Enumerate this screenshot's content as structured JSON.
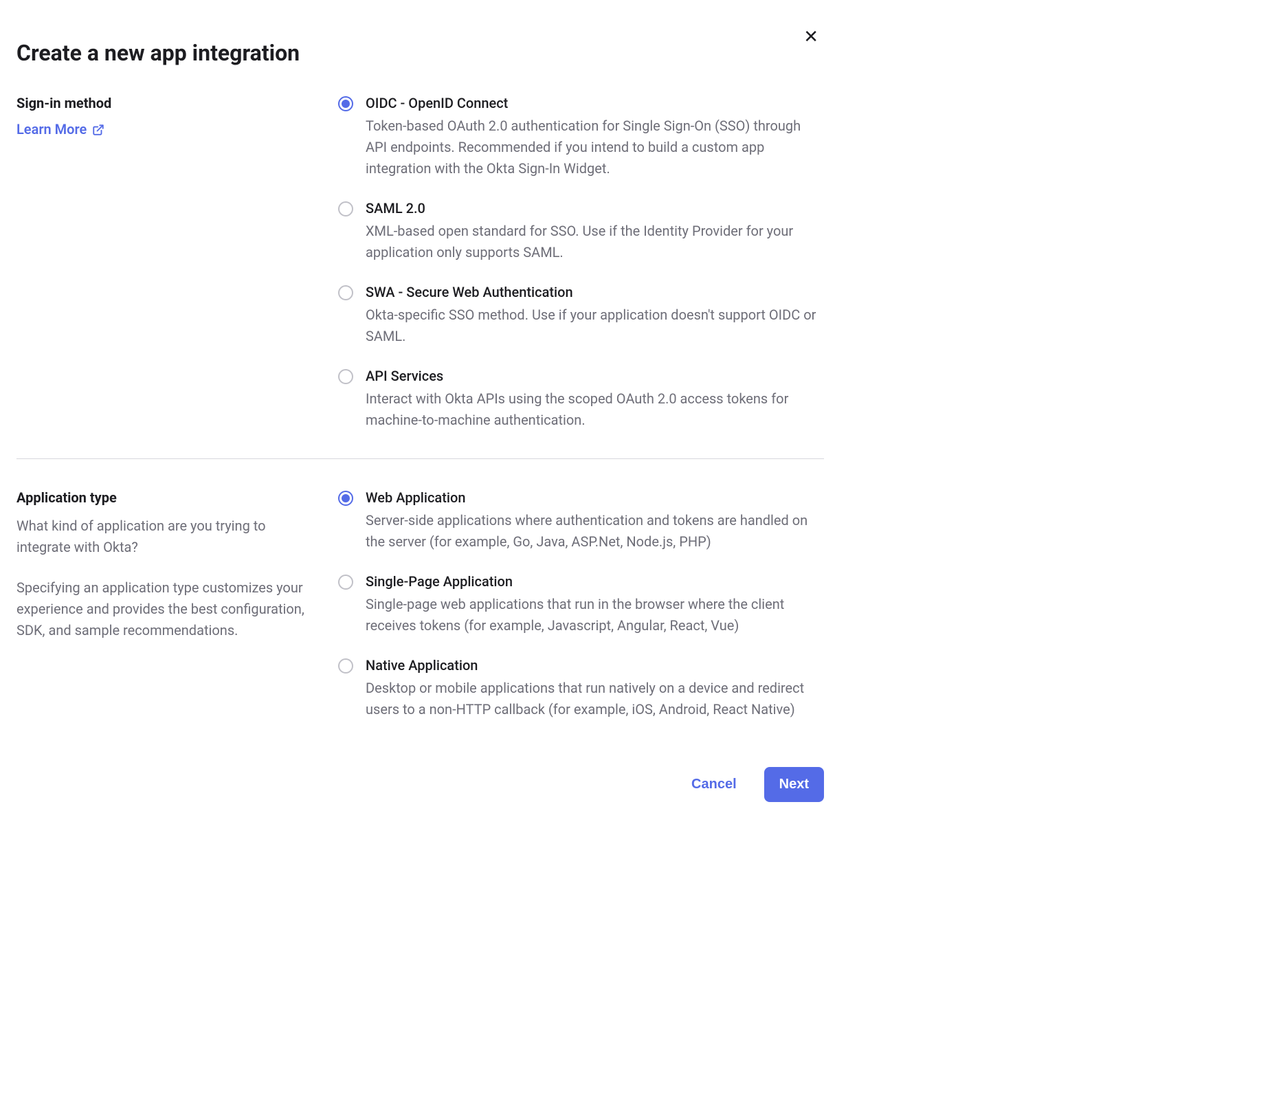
{
  "title": "Create a new app integration",
  "close_label": "✕",
  "learn_more": "Learn More",
  "sections": {
    "sign_in": {
      "heading": "Sign-in method",
      "options": [
        {
          "title": "OIDC - OpenID Connect",
          "desc": "Token-based OAuth 2.0 authentication for Single Sign-On (SSO) through API endpoints. Recommended if you intend to build a custom app integration with the Okta Sign-In Widget.",
          "selected": true
        },
        {
          "title": "SAML 2.0",
          "desc": "XML-based open standard for SSO. Use if the Identity Provider for your application only supports SAML.",
          "selected": false
        },
        {
          "title": "SWA - Secure Web Authentication",
          "desc": "Okta-specific SSO method. Use if your application doesn't support OIDC or SAML.",
          "selected": false
        },
        {
          "title": "API Services",
          "desc": "Interact with Okta APIs using the scoped OAuth 2.0 access tokens for machine-to-machine authentication.",
          "selected": false
        }
      ]
    },
    "app_type": {
      "heading": "Application type",
      "para1": "What kind of application are you trying to integrate with Okta?",
      "para2": "Specifying an application type customizes your experience and provides the best configuration, SDK, and sample recommendations.",
      "options": [
        {
          "title": "Web Application",
          "desc": "Server-side applications where authentication and tokens are handled on the server (for example, Go, Java, ASP.Net, Node.js, PHP)",
          "selected": true
        },
        {
          "title": "Single-Page Application",
          "desc": "Single-page web applications that run in the browser where the client receives tokens (for example, Javascript, Angular, React, Vue)",
          "selected": false
        },
        {
          "title": "Native Application",
          "desc": "Desktop or mobile applications that run natively on a device and redirect users to a non-HTTP callback (for example, iOS, Android, React Native)",
          "selected": false
        }
      ]
    }
  },
  "footer": {
    "cancel": "Cancel",
    "next": "Next"
  }
}
